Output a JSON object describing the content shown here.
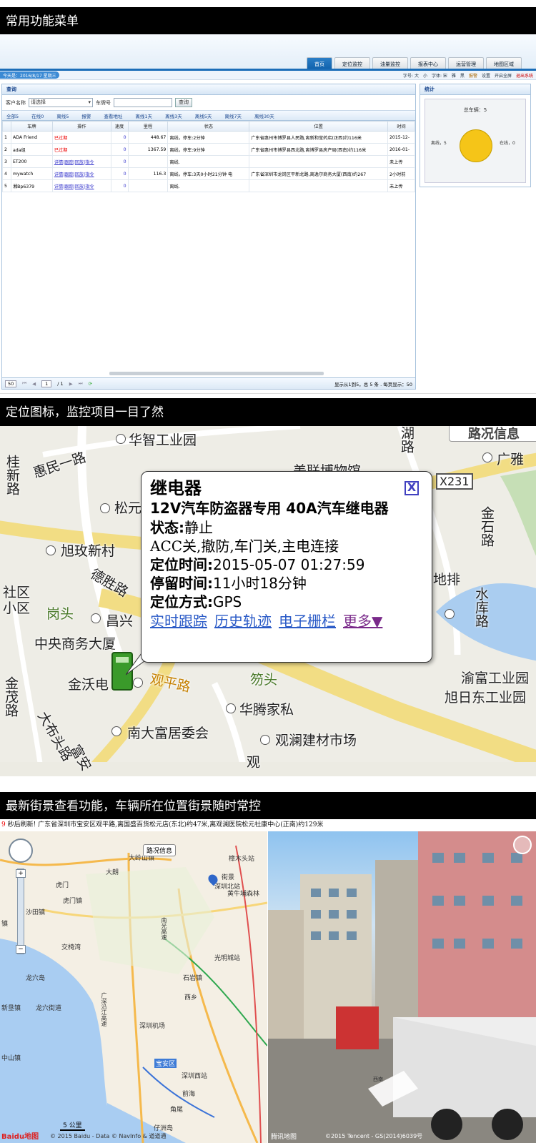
{
  "sections": {
    "s1_title": "常用功能菜单",
    "s2_title": "定位图标，监控项目一目了然",
    "s3_title": "最新街景查看功能，车辆所在位置街景随时常控"
  },
  "app": {
    "tabs": [
      "首页",
      "定位监控",
      "油量监控",
      "报表中心",
      "运营管理",
      "地图区域"
    ],
    "date_text": "今天是：2016/8/17 星期三",
    "toolbar_right": [
      "字号: 大",
      "小",
      "字体: 宋",
      "雅",
      "黑",
      "报警",
      "设置",
      "开启全屏",
      "退出系统"
    ],
    "query_title": "查询",
    "customer_label": "客户名称",
    "customer_value": "请选择",
    "plate_label": "车牌号",
    "query_button": "查询",
    "filters": [
      "全部5",
      "在线0",
      "离线5",
      "报警",
      "查看地址",
      "离线1天",
      "离线3天",
      "离线5天",
      "离线7天",
      "离线30天"
    ],
    "columns": [
      "",
      "车牌",
      "操作",
      "速度",
      "里程",
      "状态",
      "位置",
      "时间"
    ],
    "rows": [
      {
        "n": "1",
        "plate": "ADA Friend",
        "op": "已过期",
        "speed": "0",
        "mileage": "448.67",
        "status": "离线，停车:2分钟",
        "loc": "广东省惠州市博罗县人民路,离新和莹药店(正西)约116米",
        "time": "2015-12-"
      },
      {
        "n": "2",
        "plate": "ada组",
        "op": "已过期",
        "speed": "0",
        "mileage": "1367.59",
        "status": "离线，停车:9分钟",
        "loc": "广东省惠州市博罗县西北路,离博罗县房产局(西南)约116米",
        "time": "2016-01-"
      },
      {
        "n": "3",
        "plate": "ET200",
        "op": "详情|跟踪|回放|指令",
        "speed": "0",
        "mileage": "",
        "status": "离线.",
        "loc": "",
        "time": "未上传"
      },
      {
        "n": "4",
        "plate": "mywatch",
        "op": "详情|跟踪|回放|指令",
        "speed": "0",
        "mileage": "116.3",
        "status": "离线，停车:3天0小时21分钟 电",
        "loc": "广东省深圳市龙岗区平新北路,离逸尔商务大厦(西南)约267",
        "time": "2小时前"
      },
      {
        "n": "5",
        "plate": "湘Bp6379",
        "op": "详情|跟踪|回放|指令",
        "speed": "0",
        "mileage": "",
        "status": "离线.",
        "loc": "",
        "time": "未上传"
      }
    ],
    "pager_size": "50",
    "pager_page": "1",
    "pager_total": "/ 1",
    "pager_info": "显示从1到5，总 5 条 . 每页显示：50",
    "stats_title": "统计",
    "stats_total": "总车辆：5",
    "stats_offline": "离线，5",
    "stats_online": "在线，0",
    "colors": {
      "pie": "#f5c518",
      "accent": "#1b6db8"
    }
  },
  "map": {
    "labels": [
      "华智工业园",
      "惠民一路",
      "桂新路",
      "松元",
      "旭玫新村",
      "德胜路",
      "社区",
      "小区",
      "岗头",
      "昌兴",
      "中央商务大厦",
      "金沃电",
      "观平路",
      "笏头",
      "华腾家私",
      "南大富居委会",
      "观澜建材市场",
      "大布头路",
      "富安",
      "金茂路",
      "湖路",
      "广雅",
      "X231",
      "金石路",
      "水库路",
      "地排",
      "渝富工业园",
      "旭日东工业园",
      "美联博物馆",
      "路况信息",
      "观"
    ],
    "popup": {
      "title": "继电器",
      "subtitle": "12V汽车防盗器专用 40A汽车继电器",
      "status_label": "状态:",
      "status_value": "静止",
      "acc": "ACC关,撤防,车门关,主电连接",
      "time_label": "定位时间:",
      "time_value": "2015-05-07 01:27:59",
      "stay_label": "停留时间:",
      "stay_value": "11小时18分钟",
      "mode_label": "定位方式:",
      "mode_value": "GPS",
      "links": [
        "实时跟踪",
        "历史轨迹",
        "电子栅栏",
        "更多▼"
      ],
      "close": "X"
    }
  },
  "street": {
    "refresh_num": "9",
    "refresh_text": "秒后刷新!  广东省深圳市宝安区观平路,离国盛百货松元店(东北)约47米,离观澜医院松元社康中心(正南)约129米",
    "map_labels": [
      "大岭山镇",
      "大朗",
      "虎门",
      "虎门镇",
      "沙田镇",
      "镇",
      "交椅湾",
      "龙穴岛",
      "新垦镇",
      "龙穴街道",
      "中山镇",
      "西乡",
      "宝安区",
      "深圳西站",
      "深圳北站",
      "光明城站",
      "石岩镇",
      "深圳机场",
      "前海",
      "角尾",
      "仔洲岛",
      "樟木头站",
      "黄牛埔森林",
      "街景",
      "南光高速",
      "广深沿江高速"
    ],
    "road_info": "路况信息",
    "scale": "5 公里",
    "baidu": "Baidu地图",
    "copyright": "© 2015 Baidu - Data © NavInfo & 道道通",
    "tencent": "腾讯地图",
    "tencent_copy": "©2015 Tencent - GS(2014)6039号",
    "sign": "西南"
  }
}
